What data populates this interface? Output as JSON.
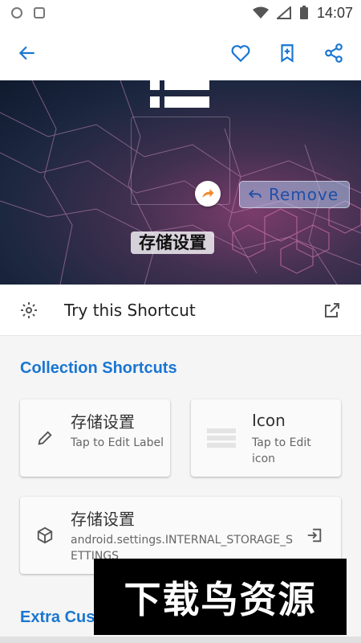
{
  "status_bar": {
    "time": "14:07"
  },
  "hero": {
    "shortcut_label": "存储设置",
    "remove_label": "Remove"
  },
  "try_shortcut": {
    "label": "Try this Shortcut"
  },
  "collection_section": {
    "title": "Collection Shortcuts",
    "label_card": {
      "title": "存储设置",
      "subtitle": "Tap to Edit Label"
    },
    "icon_card": {
      "title": "Icon",
      "subtitle": "Tap to Edit icon"
    },
    "intent_card": {
      "title": "存储设置",
      "subtitle": "android.settings.INTERNAL_STORAGE_SETTINGS"
    }
  },
  "extra_section": {
    "title": "Extra Custo"
  },
  "watermark": {
    "text": "下载鸟资源"
  },
  "colors": {
    "accent": "#1976d2",
    "card_bg": "#fafafa",
    "page_bg": "#f5f5f5"
  }
}
